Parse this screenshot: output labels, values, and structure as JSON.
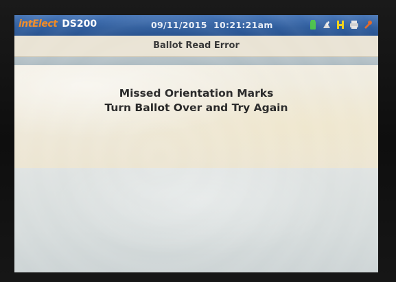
{
  "header": {
    "brand_logo": "intElect",
    "brand_model": "DS200",
    "date": "09/11/2015",
    "time": "10:21:21am"
  },
  "status_icons": [
    {
      "name": "battery-icon",
      "color": "#4cc24c"
    },
    {
      "name": "network-icon",
      "color": "#d9d9d9"
    },
    {
      "name": "h-icon",
      "color": "#f2d21b"
    },
    {
      "name": "printer-icon",
      "color": "#e6e6e6"
    },
    {
      "name": "tool-icon",
      "color": "#e06a2a"
    }
  ],
  "subheader": {
    "title": "Ballot Read Error"
  },
  "message": {
    "line1": "Missed Orientation Marks",
    "line2": "Turn Ballot Over and Try Again"
  },
  "colors": {
    "title_bar": "#2f5d9d",
    "brand_logo": "#f08a24",
    "subheader_bg": "#e9e3d4"
  }
}
